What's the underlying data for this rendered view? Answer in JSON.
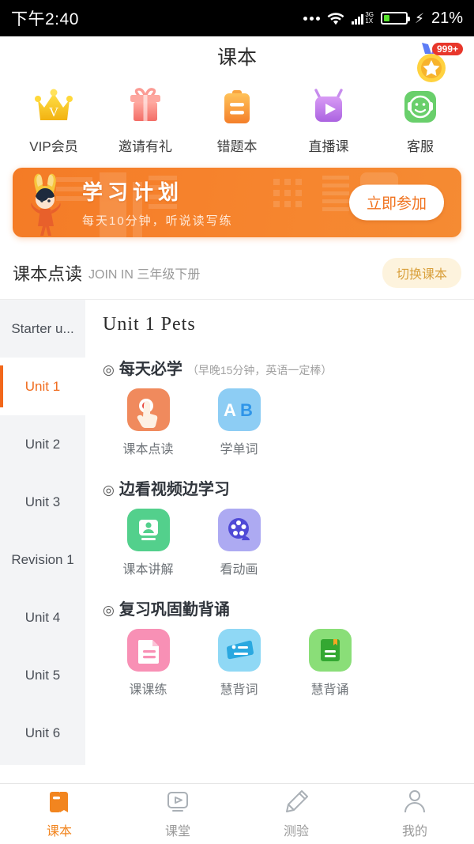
{
  "statusbar": {
    "time": "下午2:40",
    "network_type": "3G",
    "network_sub": "1X",
    "battery_percent": "21%",
    "icons": [
      "more-dots-icon",
      "wifi-icon",
      "signal-icon",
      "battery-icon",
      "charging-bolt-icon"
    ]
  },
  "header": {
    "title": "课本",
    "medal_badge": "999+",
    "medal_icon": "gold-star-medal-icon"
  },
  "quick_actions": [
    {
      "label": "VIP会员",
      "icon": "crown-icon",
      "color": "#f5c71d"
    },
    {
      "label": "邀请有礼",
      "icon": "gift-icon",
      "color": "#f8796e"
    },
    {
      "label": "错题本",
      "icon": "clipboard-icon",
      "color": "#f79a34"
    },
    {
      "label": "直播课",
      "icon": "tv-play-icon",
      "color": "#c07ae8"
    },
    {
      "label": "客服",
      "icon": "headset-icon",
      "color": "#6cd06c"
    }
  ],
  "banner": {
    "title": "学习计划",
    "subtitle": "每天10分钟，听说读写练",
    "button": "立即参加",
    "mascot_icon": "rabbit-hood-mascot-icon",
    "bg_color": "#f4781f"
  },
  "section_bar": {
    "title": "课本点读",
    "subtitle": "JOIN IN 三年级下册",
    "switch_button": "切换课本"
  },
  "sidebar": {
    "items": [
      {
        "label": "Starter u...",
        "active": false
      },
      {
        "label": "Unit 1",
        "active": true
      },
      {
        "label": "Unit 2",
        "active": false
      },
      {
        "label": "Unit 3",
        "active": false
      },
      {
        "label": "Revision 1",
        "active": false
      },
      {
        "label": "Unit 4",
        "active": false
      },
      {
        "label": "Unit 5",
        "active": false
      },
      {
        "label": "Unit 6",
        "active": false
      }
    ]
  },
  "content": {
    "unit_title": "Unit 1  Pets",
    "groups": [
      {
        "bullet": "◎",
        "title": "每天必学",
        "note": "（早晚15分钟，英语一定棒）",
        "tiles": [
          {
            "label": "课本点读",
            "icon": "tap-to-read-icon",
            "color": "#f08a5d"
          },
          {
            "label": "学单词",
            "icon": "ab-letters-icon",
            "color": "#7fc8f3"
          }
        ]
      },
      {
        "bullet": "◎",
        "title": "边看视频边学习",
        "note": "",
        "tiles": [
          {
            "label": "课本讲解",
            "icon": "lecture-monitor-icon",
            "color": "#53d08c"
          },
          {
            "label": "看动画",
            "icon": "film-reel-icon",
            "color": "#a8a8f0"
          }
        ]
      },
      {
        "bullet": "◎",
        "title": "复习巩固勤背诵",
        "note": "",
        "tiles": [
          {
            "label": "课课练",
            "icon": "worksheet-icon",
            "color": "#f890b5"
          },
          {
            "label": "慧背词",
            "icon": "word-card-icon",
            "color": "#68c8f0"
          },
          {
            "label": "慧背诵",
            "icon": "green-book-icon",
            "color": "#7ad464"
          }
        ]
      }
    ]
  },
  "bottom_nav": {
    "items": [
      {
        "label": "课本",
        "icon": "book-icon",
        "active": true
      },
      {
        "label": "课堂",
        "icon": "monitor-play-icon",
        "active": false
      },
      {
        "label": "测验",
        "icon": "pencil-icon",
        "active": false
      },
      {
        "label": "我的",
        "icon": "person-icon",
        "active": false
      }
    ],
    "active_color": "#f2851f"
  }
}
